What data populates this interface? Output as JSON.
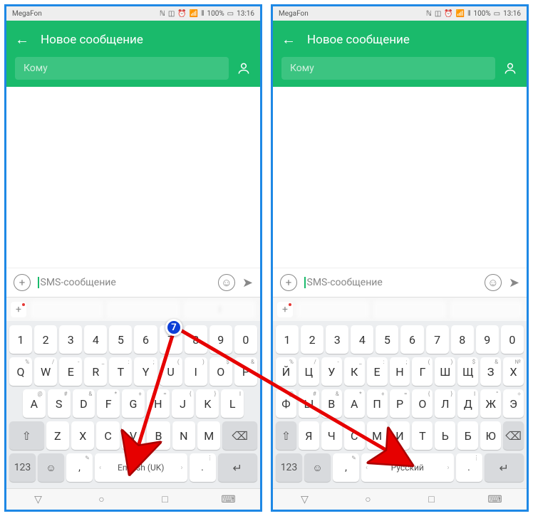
{
  "statusbar": {
    "carrier": "MegaFon",
    "battery": "100%",
    "time": "13:16"
  },
  "header": {
    "title": "Новое сообщение",
    "to_placeholder": "Кому"
  },
  "composer": {
    "placeholder": "SMS-сообщение"
  },
  "kb_en": {
    "row0": [
      "1",
      "2",
      "3",
      "4",
      "5",
      "6",
      "7",
      "8",
      "9",
      "0"
    ],
    "row1": {
      "keys": [
        "Q",
        "W",
        "E",
        "R",
        "T",
        "Y",
        "U",
        "I",
        "O",
        "P"
      ],
      "hints": [
        "%",
        "/",
        "-",
        "_",
        ":",
        ";",
        "(",
        ")",
        "$",
        "&"
      ]
    },
    "row2": {
      "keys": [
        "A",
        "S",
        "D",
        "F",
        "G",
        "H",
        "J",
        "K",
        "L"
      ],
      "hints": [
        "@",
        "#",
        "&",
        "*",
        "+",
        "=",
        "{",
        "}",
        "I"
      ]
    },
    "row3": [
      "Z",
      "X",
      "C",
      "V",
      "B",
      "N",
      "M"
    ],
    "space": "English (UK)",
    "fn123": "123"
  },
  "kb_ru": {
    "row0": [
      "1",
      "2",
      "3",
      "4",
      "5",
      "6",
      "7",
      "8",
      "9",
      "0"
    ],
    "row1": {
      "keys": [
        "Й",
        "Ц",
        "У",
        "К",
        "Е",
        "Н",
        "Г",
        "Ш",
        "Щ",
        "З",
        "Х"
      ],
      "hints": [
        "%",
        "/",
        "-",
        "_",
        ":",
        ";",
        "(",
        ")",
        "$",
        "&",
        "№"
      ]
    },
    "row2": {
      "keys": [
        "Ф",
        "Ы",
        "В",
        "А",
        "П",
        "Р",
        "О",
        "Л",
        "Д",
        "Ж",
        "Э"
      ],
      "hints": [
        "@",
        "#",
        "&",
        "*",
        "+",
        "=",
        "{",
        "}",
        "I",
        "°",
        "÷"
      ]
    },
    "row3": [
      "Я",
      "Ч",
      "С",
      "М",
      "И",
      "Т",
      "Ь",
      "Б",
      "Ю"
    ],
    "space": "Русский",
    "fn123": "123"
  },
  "annotation": {
    "badge": "7"
  }
}
